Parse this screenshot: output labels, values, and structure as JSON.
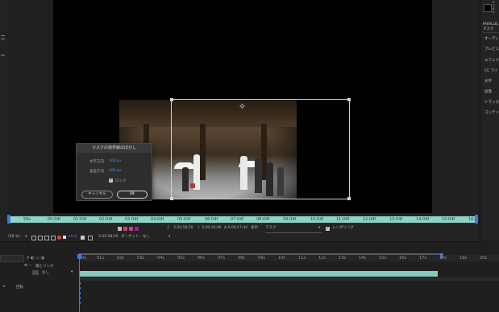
{
  "dialog": {
    "title": "マスクの境界線のぼかし",
    "horizontal_label": "水平方向",
    "horizontal_value": "100 px",
    "vertical_label": "垂直方向",
    "vertical_value": "100 px",
    "lock_label": "ロック",
    "lock_checked": true,
    "cancel_label": "キャンセル",
    "ok_label": "OK"
  },
  "right_panel": {
    "swatch_letters": [
      "R",
      "G",
      "B",
      "A"
    ],
    "title": "PARALLEL",
    "mask_label": "マスク",
    "items": [
      "オーディ",
      "プレビュ",
      "エフェク",
      "CC ライ",
      "文字",
      "段落",
      "トラッカ",
      "コンテン"
    ]
  },
  "ruler": {
    "timecodes": [
      "59s",
      "00:04f",
      "01:04f",
      "02:04f",
      "03:04f",
      "04:04f",
      "05:04f",
      "06:04f",
      "07:04f",
      "08:04f",
      "09:04f",
      "10:04f",
      "11:04f",
      "12:04f",
      "13:04f",
      "14:04f",
      "15:04f",
      "16:"
    ]
  },
  "viewer_toolbar": {
    "start_time": "3;35;58;20",
    "end_time": "3;36;16;06",
    "duration": "Δ 0;00;17;44",
    "view_label": "表示:",
    "view_value": "マスク",
    "rendering_label": "レンダリング",
    "rendering_checked": true
  },
  "viewer_toolbar2": {
    "zoom": "(58 %)",
    "exposure": "+0.0",
    "timecode": "3;35;58;20",
    "target_label": "ターゲット：なし"
  },
  "timeline": {
    "parent_label": "親とリンク",
    "none_label": "なし",
    "rotate_label": "回転",
    "timecodes": [
      "00s",
      "01s",
      "02s",
      "03s",
      "04s",
      "05s",
      "06s",
      "07s",
      "08s",
      "09s",
      "10s",
      "11s",
      "12s",
      "13s",
      "14s",
      "15s",
      "16s",
      "17s",
      "18s",
      "19s",
      "20s"
    ]
  },
  "colors": {
    "ruler_fill": "#8fd3c8",
    "cti_blue": "#3b7fe0",
    "accent_link": "#4d8ee8"
  }
}
